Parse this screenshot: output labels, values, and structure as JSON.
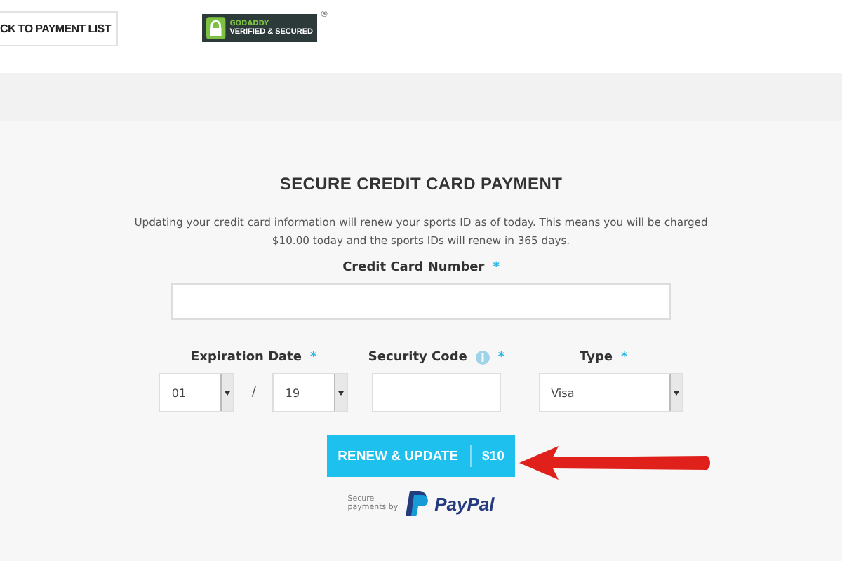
{
  "back_button": {
    "label": "CK TO PAYMENT LIST"
  },
  "badge": {
    "brand": "GODADDY",
    "label": "VERIFIED & SECURED",
    "mark": "®"
  },
  "title": "SECURE CREDIT CARD PAYMENT",
  "description": "Updating your credit card information will renew your sports ID as of today. This means you will be charged $10.00 today and the sports IDs will renew in 365 days.",
  "card_number": {
    "label": "Credit Card Number",
    "required_mark": "*"
  },
  "expiration": {
    "label": "Expiration Date",
    "required_mark": "*",
    "month": "01",
    "separator": "/",
    "year": "19"
  },
  "security_code": {
    "label": "Security Code",
    "required_mark": "*"
  },
  "type": {
    "label": "Type",
    "required_mark": "*",
    "value": "Visa"
  },
  "submit": {
    "label": "RENEW & UPDATE",
    "price": "$10"
  },
  "paypal": {
    "caption_1": "Secure",
    "caption_2": "payments by",
    "brand": "PayPal"
  }
}
